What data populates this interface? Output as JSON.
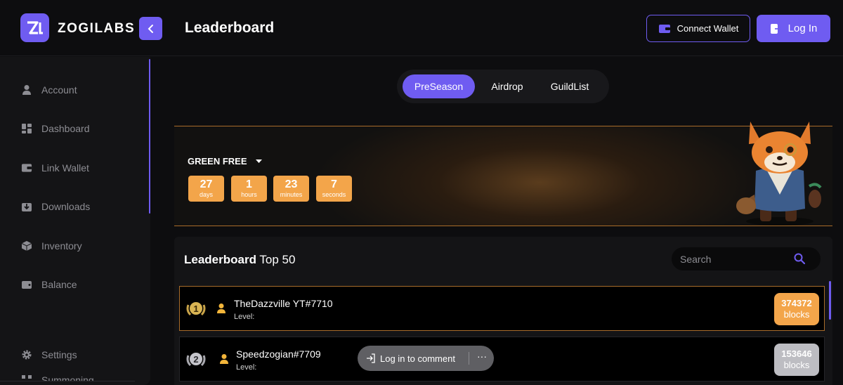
{
  "brand": {
    "name": "ZOGILABS",
    "accent": "#6f5cf1",
    "gold": "#f3a54a"
  },
  "header": {
    "title": "Leaderboard",
    "connect_wallet": "Connect Wallet",
    "login": "Log In"
  },
  "sidebar": {
    "items": [
      {
        "label": "Account",
        "icon": "user-icon"
      },
      {
        "label": "Dashboard",
        "icon": "grid-icon"
      },
      {
        "label": "Link Wallet",
        "icon": "wallet-icon"
      },
      {
        "label": "Downloads",
        "icon": "download-icon"
      },
      {
        "label": "Inventory",
        "icon": "box-icon"
      },
      {
        "label": "Balance",
        "icon": "balance-icon"
      },
      {
        "label": "Summoning",
        "icon": "summon-icon"
      }
    ],
    "settings": {
      "label": "Settings",
      "icon": "gear-icon"
    }
  },
  "tabs": [
    {
      "label": "PreSeason",
      "active": true
    },
    {
      "label": "Airdrop",
      "active": false
    },
    {
      "label": "GuildList",
      "active": false
    }
  ],
  "banner": {
    "season": "GREEN FREE",
    "countdown": [
      {
        "value": "27",
        "unit": "days"
      },
      {
        "value": "1",
        "unit": "hours"
      },
      {
        "value": "23",
        "unit": "minutes"
      },
      {
        "value": "7",
        "unit": "seconds"
      }
    ]
  },
  "leaderboard": {
    "title_bold": "Leaderboard",
    "title_rest": " Top 50",
    "search_placeholder": "Search",
    "rows": [
      {
        "rank": "1",
        "name": "TheDazzville YT#7710",
        "level": "Level:",
        "score": "374372",
        "unit": "blocks"
      },
      {
        "rank": "2",
        "name": "Speedzogian#7709",
        "level": "Level:",
        "score": "153646",
        "unit": "blocks"
      }
    ]
  },
  "comment_pill": {
    "label": "Log in to comment",
    "more": "···"
  }
}
